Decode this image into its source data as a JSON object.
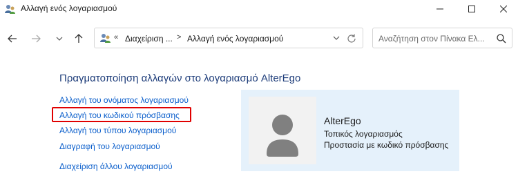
{
  "window": {
    "title": "Αλλαγή ενός λογαριασμού"
  },
  "nav": {
    "breadcrumb": {
      "separator_start": "«",
      "crumb1": "Διαχείριση ...",
      "separator": ">",
      "crumb2": "Αλλαγή ενός λογαριασμού"
    },
    "search_placeholder": "Αναζήτηση στον Πίνακα Ελ..."
  },
  "main": {
    "heading": "Πραγματοποίηση αλλαγών στο λογαριασμό AlterEgo",
    "links": [
      "Αλλαγή του ονόματος λογαριασμού",
      "Αλλαγή του κωδικού πρόσβασης",
      "Αλλαγή του τύπου λογαριασμού",
      "Διαγραφή του λογαριασμού",
      "Διαχείριση άλλου λογαριασμού"
    ]
  },
  "account": {
    "name": "AlterEgo",
    "type": "Τοπικός λογαριασμός",
    "protection": "Προστασία με κωδικό πρόσβασης"
  },
  "colors": {
    "link": "#0a5ecb",
    "heading": "#1e3d7a",
    "panel_bg": "#e5f1fb",
    "highlight": "#e00000"
  }
}
